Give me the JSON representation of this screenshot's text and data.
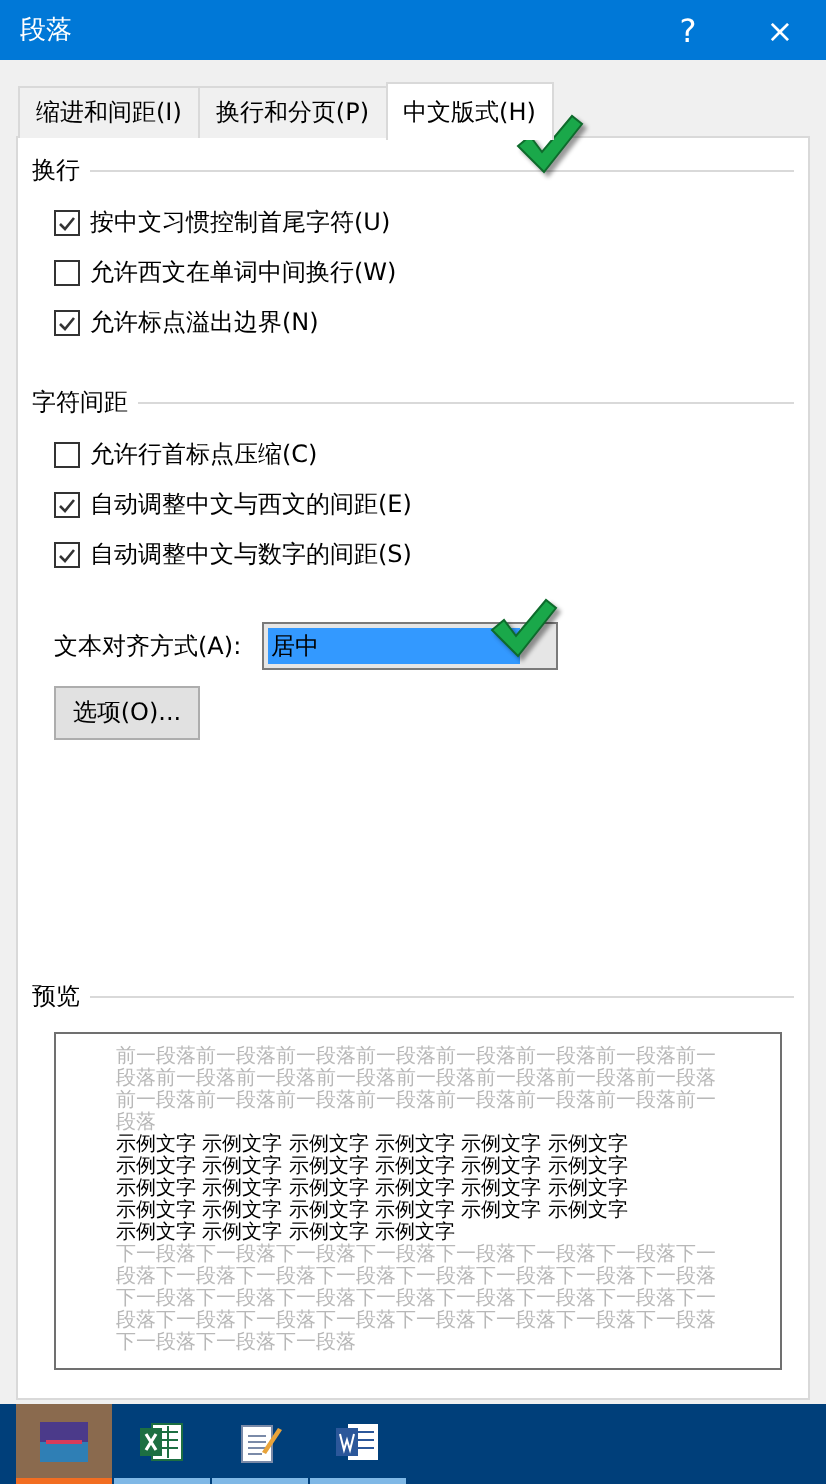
{
  "window": {
    "title": "段落",
    "help": "?",
    "close": "×"
  },
  "tabs": [
    {
      "label": "缩进和间距(I)",
      "selected": false
    },
    {
      "label": "换行和分页(P)",
      "selected": false
    },
    {
      "label": "中文版式(H)",
      "selected": true
    }
  ],
  "sections": [
    {
      "title": "换行",
      "options": [
        {
          "label": "按中文习惯控制首尾字符(U)",
          "checked": true
        },
        {
          "label": "允许西文在单词中间换行(W)",
          "checked": false
        },
        {
          "label": "允许标点溢出边界(N)",
          "checked": true
        }
      ]
    },
    {
      "title": "字符间距",
      "options": [
        {
          "label": "允许行首标点压缩(C)",
          "checked": false
        },
        {
          "label": "自动调整中文与西文的间距(E)",
          "checked": true
        },
        {
          "label": "自动调整中文与数字的间距(S)",
          "checked": true
        }
      ]
    }
  ],
  "alignment": {
    "label": "文本对齐方式(A):",
    "value": "居中"
  },
  "options_button": "选项(O)...",
  "preview": {
    "title": "预览",
    "previous_paragraph": "前一段落前一段落前一段落前一段落前一段落前一段落前一段落前一段落前一段落前一段落前一段落前一段落前一段落前一段落前一段落前一段落前一段落前一段落前一段落前一段落前一段落前一段落前一段落",
    "sample_lines": [
      "示例文字 示例文字 示例文字 示例文字 示例文字 示例文字",
      "示例文字 示例文字 示例文字 示例文字 示例文字 示例文字",
      "示例文字 示例文字 示例文字 示例文字 示例文字 示例文字",
      "示例文字 示例文字 示例文字 示例文字 示例文字 示例文字",
      "示例文字 示例文字 示例文字 示例文字"
    ],
    "next_paragraph": "下一段落下一段落下一段落下一段落下一段落下一段落下一段落下一段落下一段落下一段落下一段落下一段落下一段落下一段落下一段落下一段落下一段落下一段落下一段落下一段落下一段落下一段落下一段落下一段落下一段落下一段落下一段落下一段落下一段落下一段落下一段落下一段落下一段落"
  },
  "taskbar": [
    {
      "kind": "thumbnail",
      "selected": true
    },
    {
      "kind": "excel",
      "selected": false
    },
    {
      "kind": "notepad",
      "selected": false
    },
    {
      "kind": "word",
      "selected": false
    }
  ]
}
